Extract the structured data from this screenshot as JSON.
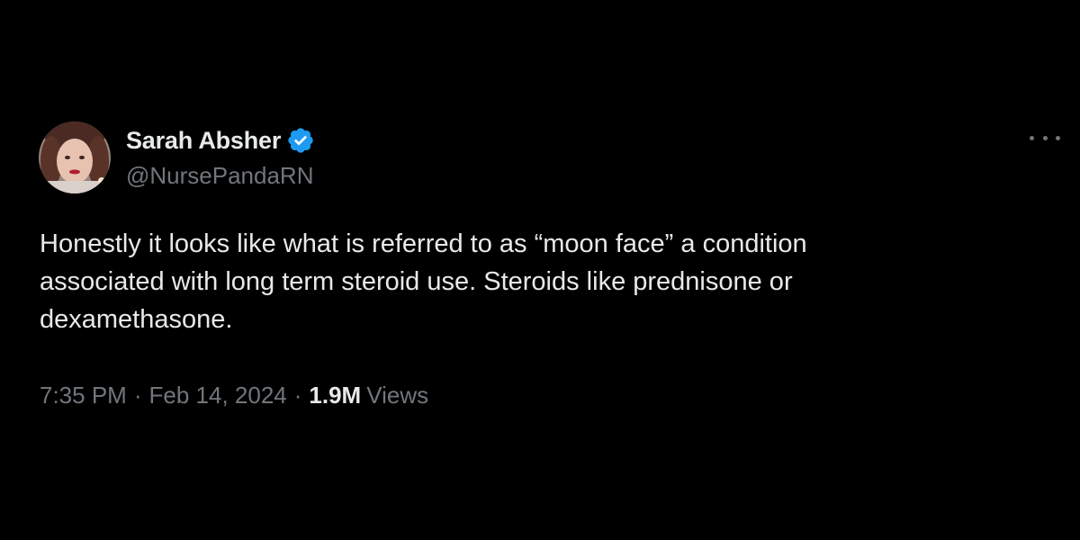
{
  "author": {
    "display_name": "Sarah Absher",
    "handle": "@NursePandaRN",
    "verified": true
  },
  "tweet": {
    "text": "Honestly it looks like what is referred to as “moon face” a condition\nassociated with long term steroid use. Steroids like prednisone or\ndexamethasone.",
    "time": "7:35 PM",
    "date": "Feb 14, 2024",
    "separator": "·",
    "views_count": "1.9M",
    "views_label": "Views"
  },
  "icons": {
    "verified": "verified-badge-icon",
    "more": "more-options-icon"
  },
  "colors": {
    "background": "#000000",
    "primary_text": "#e7e9ea",
    "secondary_text": "#71767b",
    "verified_blue": "#1d9bf0"
  }
}
